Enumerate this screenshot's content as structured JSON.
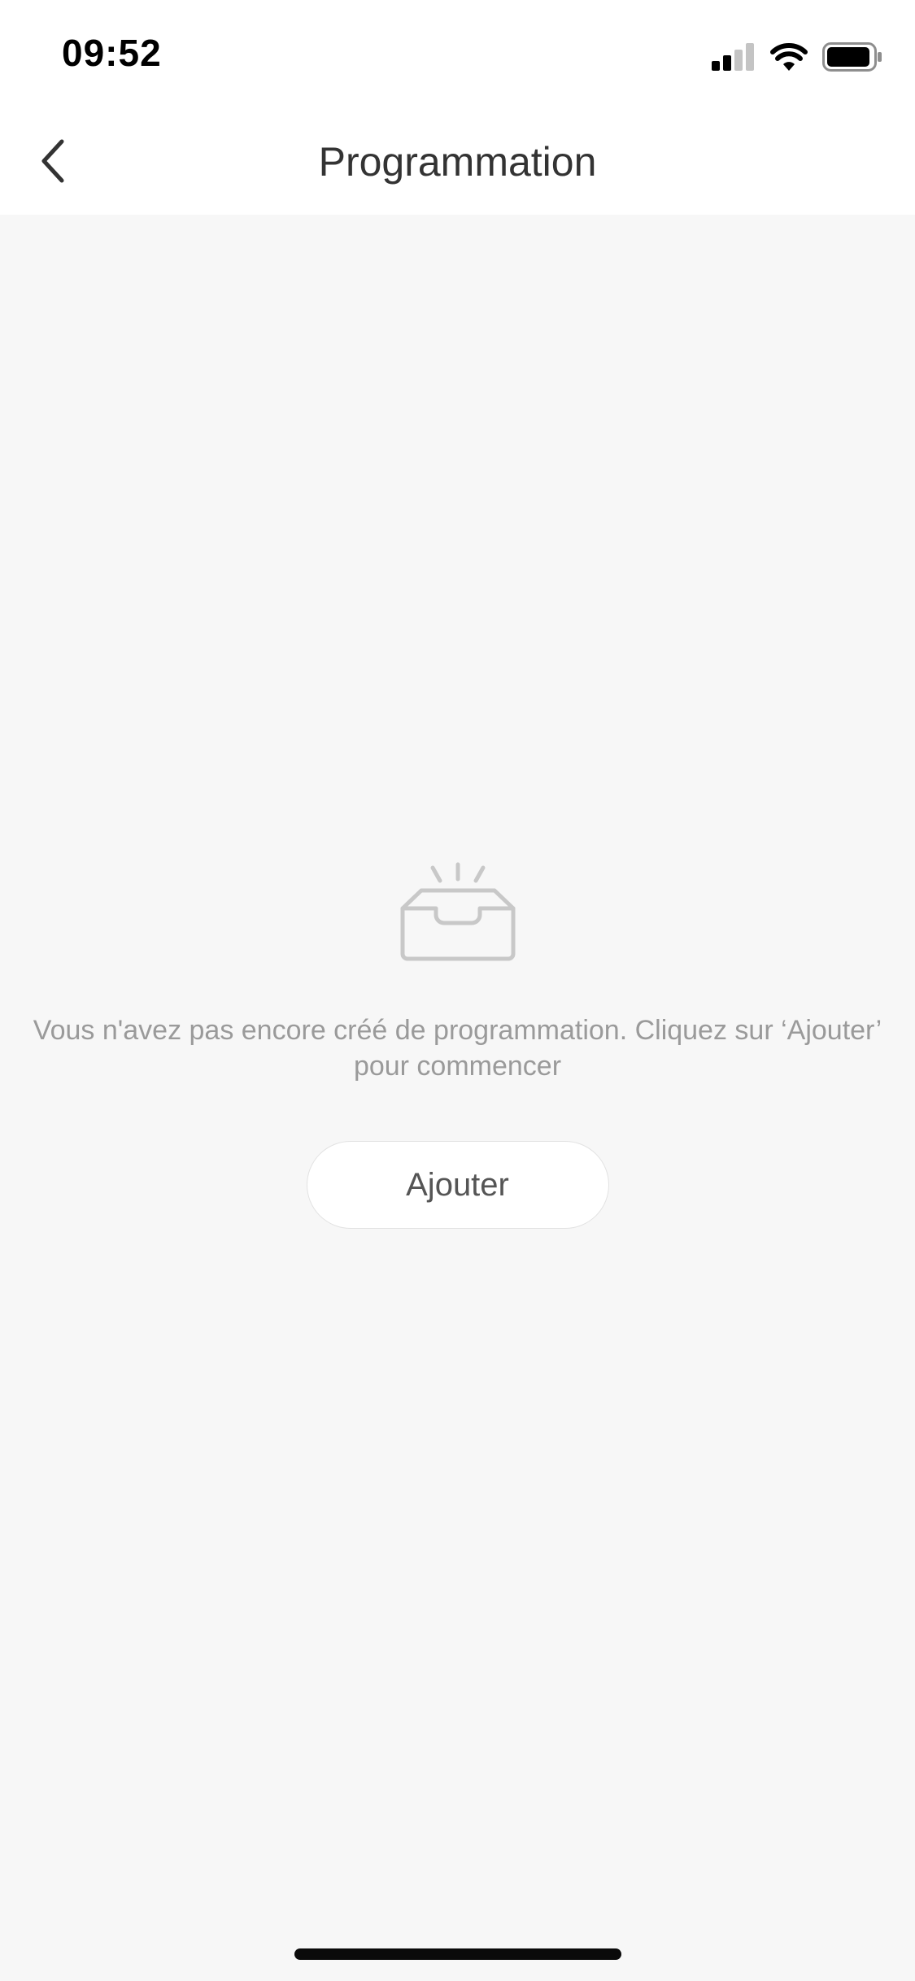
{
  "status_bar": {
    "time": "09:52",
    "icons": [
      "signal-icon",
      "wifi-icon",
      "battery-icon"
    ]
  },
  "nav": {
    "title": "Programmation",
    "back_icon": "chevron-left-icon"
  },
  "empty_state": {
    "icon": "empty-inbox-icon",
    "message": "Vous n'avez pas encore créé de programmation. Cliquez sur ‘Ajouter’ pour commencer",
    "add_label": "Ajouter"
  },
  "colors": {
    "background": "#f7f7f7",
    "header": "#ffffff",
    "title_text": "#333333",
    "muted_text": "#9a9a9a",
    "icon_gray": "#c8c8c8"
  }
}
